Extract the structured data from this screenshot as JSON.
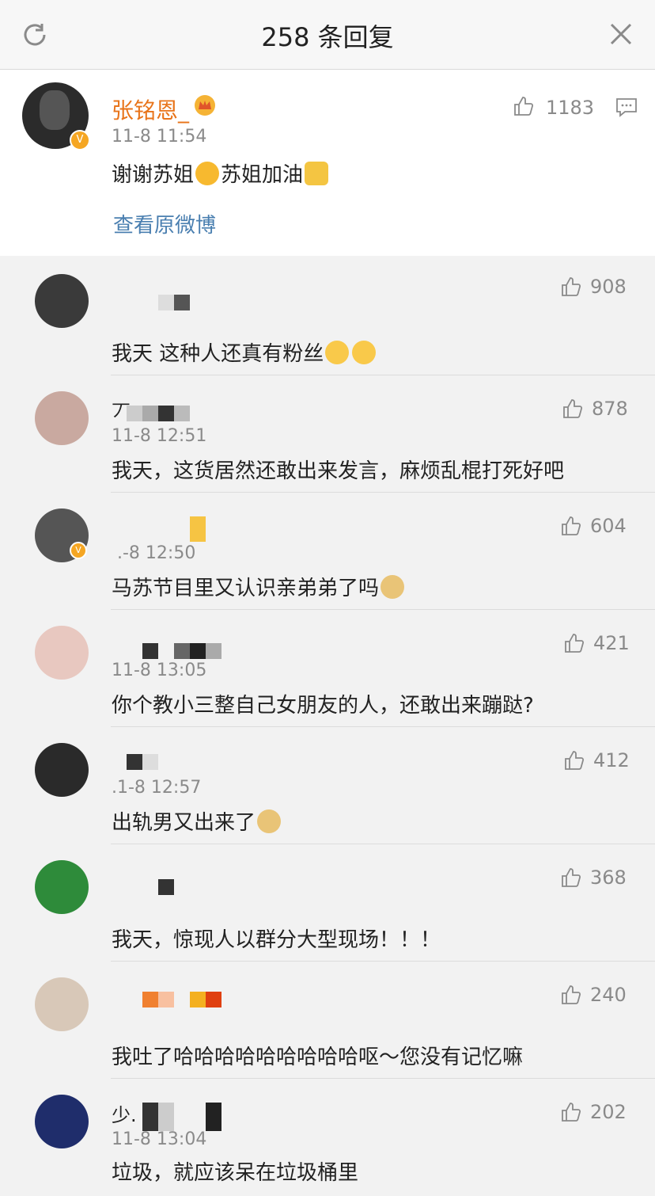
{
  "header": {
    "title": "258 条回复"
  },
  "main_comment": {
    "name": "张铭恩_",
    "time": "11-8 11:54",
    "text_a": "谢谢苏姐",
    "text_b": "苏姐加油",
    "likes": "1183",
    "view_original": "查看原微博"
  },
  "replies": [
    {
      "time": "",
      "text": "我天  这种人还真有粉丝",
      "likes": "908",
      "avatar_color": "#3a3a3a"
    },
    {
      "time": "11-8 12:51",
      "text": "我天，这货居然还敢出来发言，麻烦乱棍打死好吧",
      "likes": "878",
      "avatar_color": "#c9a9a0"
    },
    {
      "time": ".-8 12:50",
      "text": "马苏节目里又认识亲弟弟了吗",
      "likes": "604",
      "avatar_color": "#555"
    },
    {
      "time": "11-8 13:05",
      "text": "你个教小三整自己女朋友的人，还敢出来蹦跶?",
      "likes": "421",
      "avatar_color": "#e8c8c0"
    },
    {
      "time": ".1-8 12:57",
      "text": "出轨男又出来了",
      "likes": "412",
      "avatar_color": "#2a2a2a"
    },
    {
      "time": "",
      "text": "我天，惊现人以群分大型现场！！！",
      "likes": "368",
      "avatar_color": "#2e8b3a"
    },
    {
      "time": "",
      "text": "我吐了哈哈哈哈哈哈哈哈哈呕～您没有记忆嘛",
      "likes": "240",
      "avatar_color": "#d8c8b8"
    },
    {
      "time": "11-8 13:04",
      "text": "垃圾，就应该呆在垃圾桶里",
      "likes": "202",
      "avatar_color": "#1f2d6b"
    }
  ],
  "reply_name_prefix": {
    "r2": "丆",
    "r8": "少."
  }
}
